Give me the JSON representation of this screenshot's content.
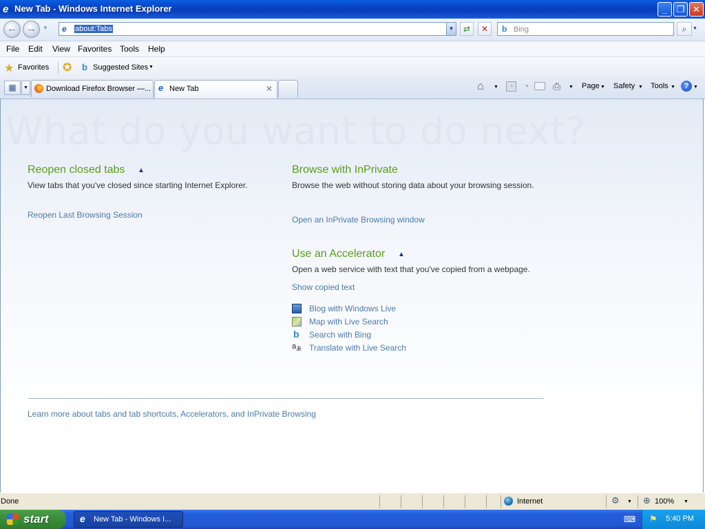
{
  "window": {
    "title": "New Tab - Windows Internet Explorer",
    "controls": {
      "minimize": "_",
      "maximize": "❐",
      "close": "✕"
    }
  },
  "address": {
    "url": "about:Tabs"
  },
  "search": {
    "placeholder": "Bing"
  },
  "menu": [
    "File",
    "Edit",
    "View",
    "Favorites",
    "Tools",
    "Help"
  ],
  "favorites_bar": {
    "favorites_label": "Favorites",
    "suggested_label": "Suggested Sites"
  },
  "tabs": [
    {
      "label": "Download Firefox Browser —..."
    },
    {
      "label": "New Tab"
    }
  ],
  "command_bar": {
    "page": "Page",
    "safety": "Safety",
    "tools": "Tools"
  },
  "content": {
    "headline": "What do you want to do next?",
    "reopen": {
      "title": "Reopen closed tabs",
      "description": "View tabs that you've closed since starting Internet Explorer.",
      "link": "Reopen Last Browsing Session"
    },
    "inprivate": {
      "title": "Browse with InPrivate",
      "description": "Browse the web without storing data about your browsing session.",
      "link": "Open an InPrivate Browsing window"
    },
    "accelerator": {
      "title": "Use an Accelerator",
      "description": "Open a web service with text that you've copied from a webpage.",
      "show_copied": "Show copied text",
      "items": [
        "Blog with Windows Live",
        "Map with Live Search",
        "Search with Bing",
        "Translate with Live Search"
      ]
    },
    "learn_more": "Learn more about tabs and tab shortcuts, Accelerators, and InPrivate Browsing"
  },
  "status": {
    "text": "Done",
    "zone": "Internet",
    "zoom": "100%"
  },
  "taskbar": {
    "start": "start",
    "task": "New Tab - Windows I...",
    "clock": "5:40 PM"
  },
  "colors": {
    "link": "#4a7aa8",
    "section_title": "#5a9c1a",
    "headline": "#dde6f2"
  }
}
